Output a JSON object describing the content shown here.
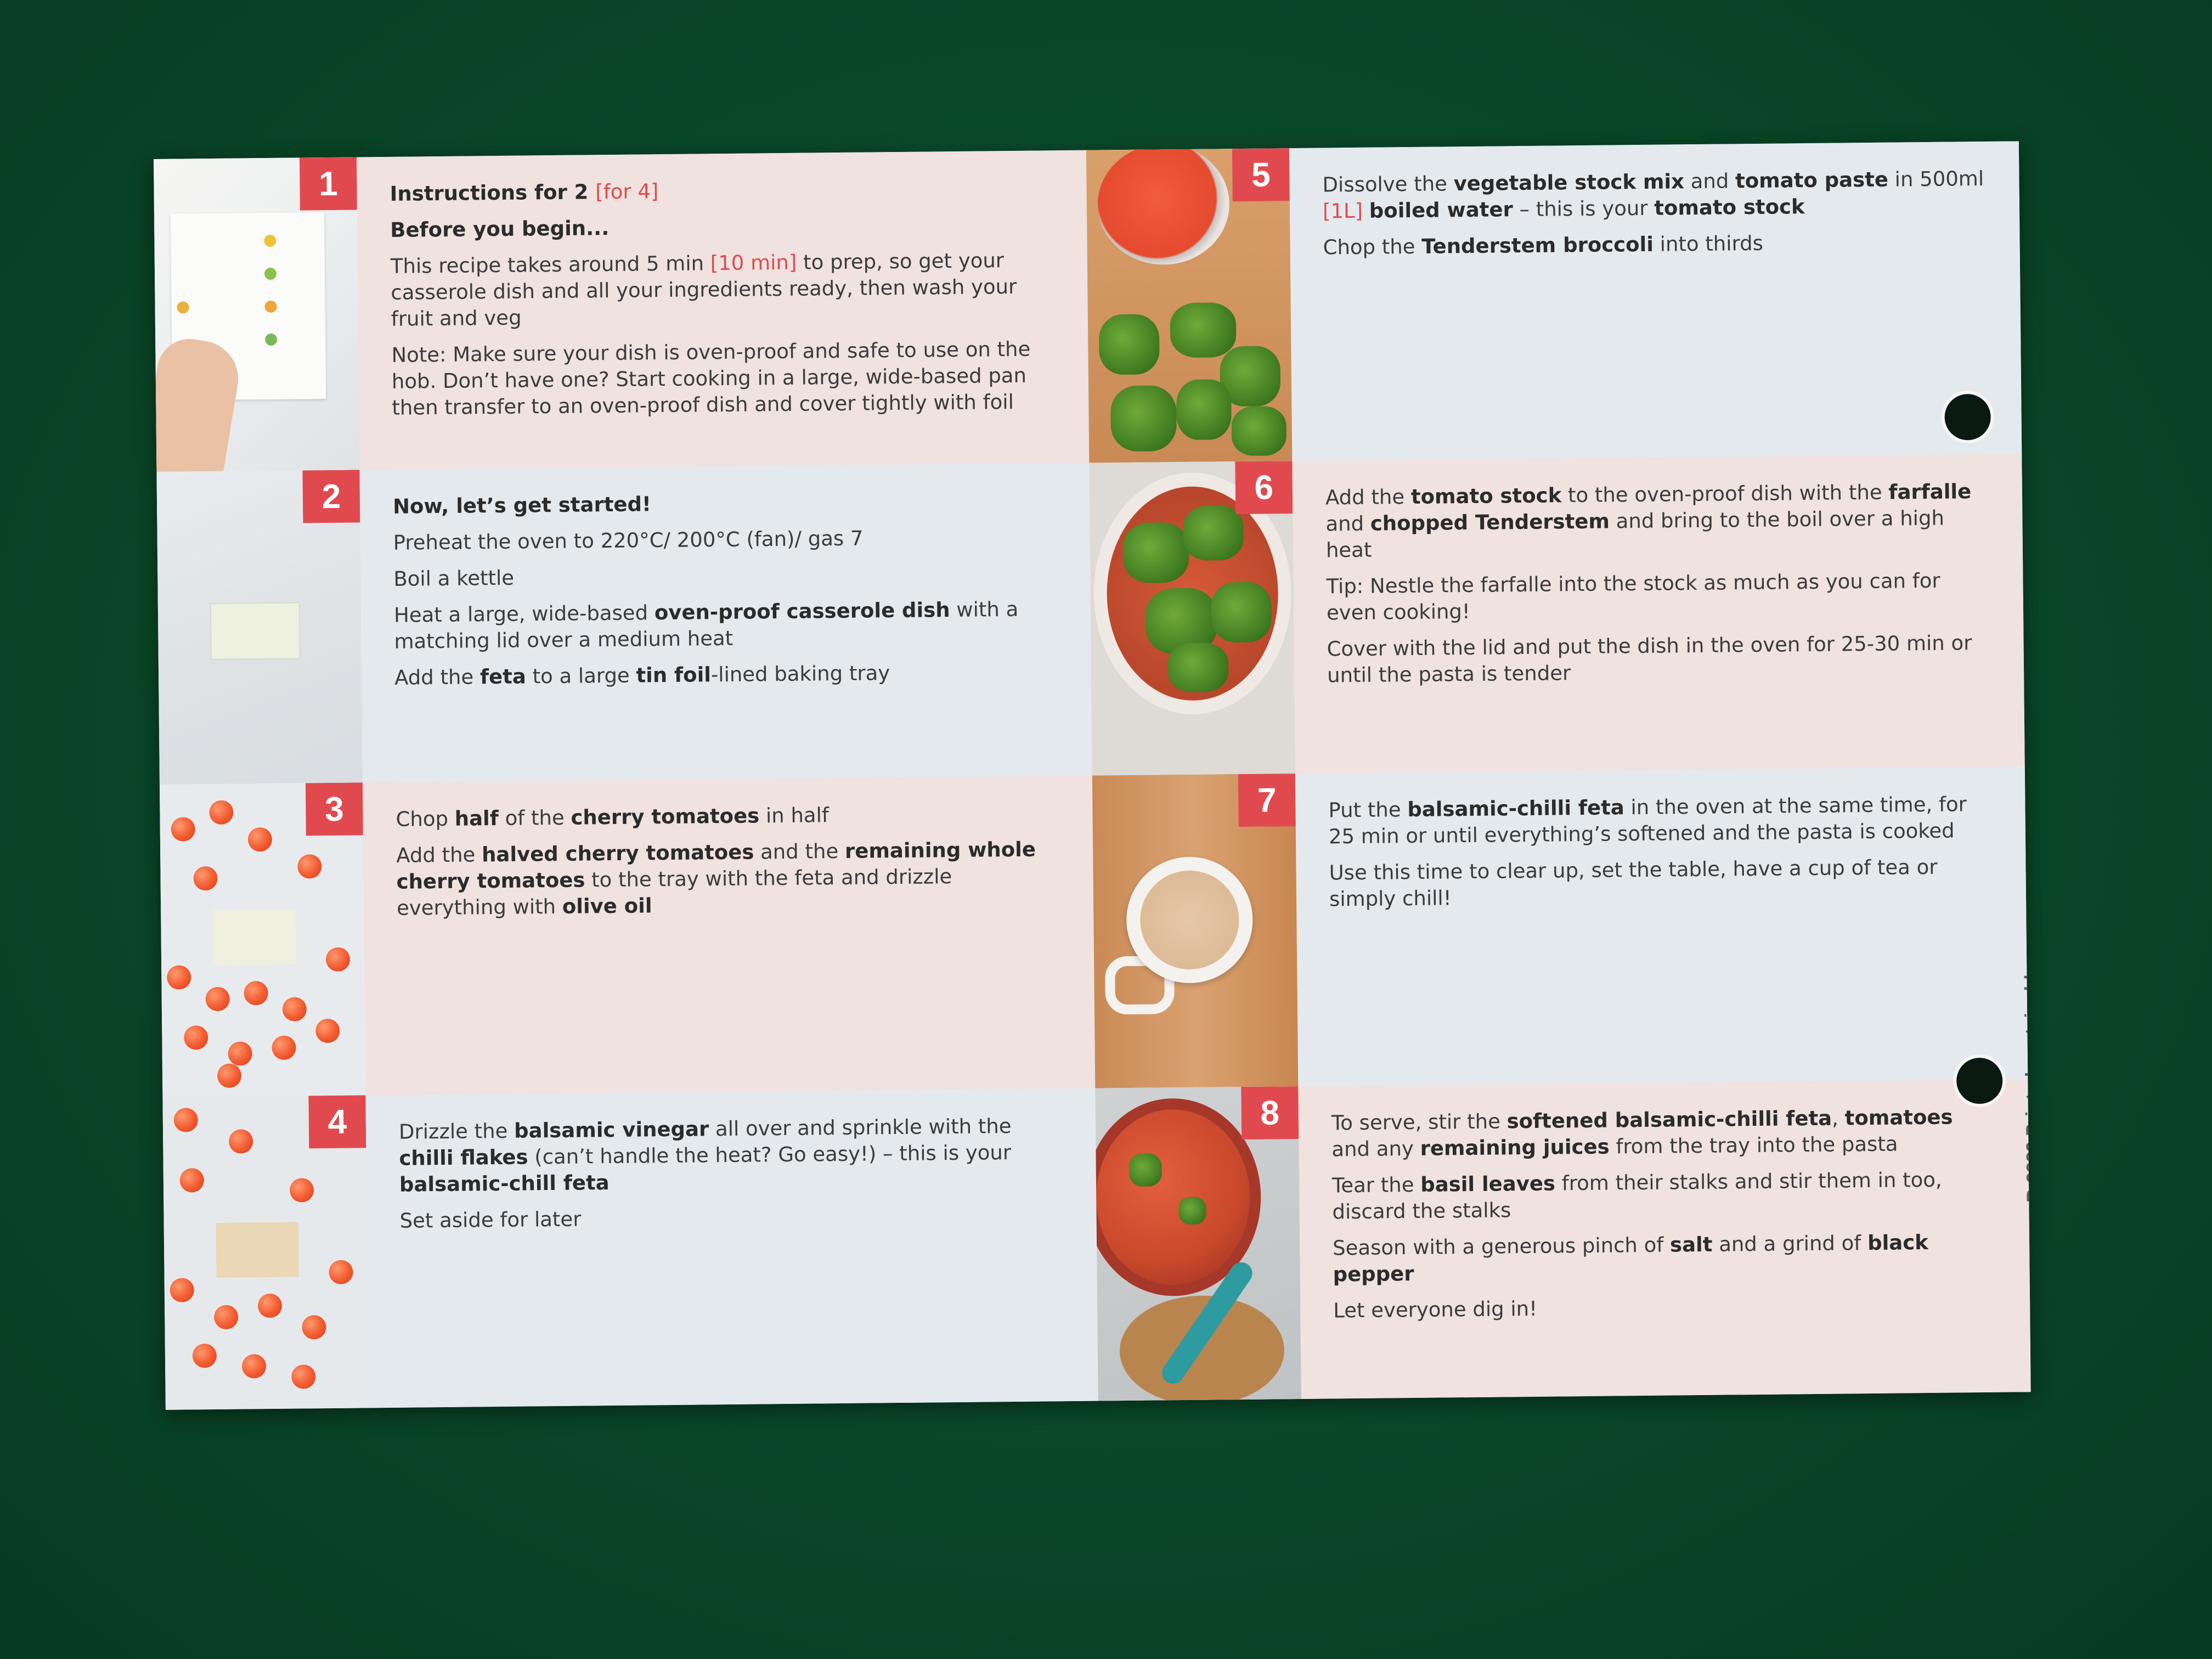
{
  "steps": [
    {
      "number": "1",
      "lines": [
        {
          "parts": [
            {
              "t": "Instructions for 2 ",
              "b": true
            },
            {
              "t": "[for 4]",
              "hl": true
            }
          ]
        },
        {
          "parts": [
            {
              "t": "Before you begin...",
              "b": true
            }
          ]
        },
        {
          "parts": [
            {
              "t": "This recipe takes around 5 min "
            },
            {
              "t": "[10 min]",
              "hl": true
            },
            {
              "t": " to prep, so get your casserole dish and all your ingredients ready, then wash your fruit and veg"
            }
          ]
        },
        {
          "parts": [
            {
              "t": "Note: Make sure your dish is oven-proof and safe to use on the hob. Don’t have one? Start cooking in a large, wide-based pan then transfer to an oven-proof dish and cover tightly with foil"
            }
          ]
        }
      ]
    },
    {
      "number": "2",
      "lines": [
        {
          "parts": [
            {
              "t": "Now, let’s get started!",
              "b": true
            }
          ]
        },
        {
          "parts": [
            {
              "t": "Preheat the oven to 220°C/ 200°C (fan)/ gas 7"
            }
          ]
        },
        {
          "parts": [
            {
              "t": "Boil a kettle"
            }
          ]
        },
        {
          "parts": [
            {
              "t": "Heat a large, wide-based "
            },
            {
              "t": "oven-proof casserole dish",
              "b": true
            },
            {
              "t": " with a matching lid over a medium heat"
            }
          ]
        },
        {
          "parts": [
            {
              "t": "Add the "
            },
            {
              "t": "feta",
              "b": true
            },
            {
              "t": " to a large "
            },
            {
              "t": "tin foil",
              "b": true
            },
            {
              "t": "-lined baking tray"
            }
          ]
        }
      ]
    },
    {
      "number": "3",
      "lines": [
        {
          "parts": [
            {
              "t": "Chop "
            },
            {
              "t": "half",
              "b": true
            },
            {
              "t": " of the "
            },
            {
              "t": "cherry tomatoes",
              "b": true
            },
            {
              "t": " in half"
            }
          ]
        },
        {
          "parts": [
            {
              "t": "Add the "
            },
            {
              "t": "halved cherry tomatoes",
              "b": true
            },
            {
              "t": " and the "
            },
            {
              "t": "remaining whole cherry tomatoes",
              "b": true
            },
            {
              "t": " to the tray with the feta and drizzle everything with "
            },
            {
              "t": "olive oil",
              "b": true
            }
          ]
        }
      ]
    },
    {
      "number": "4",
      "lines": [
        {
          "parts": [
            {
              "t": "Drizzle the "
            },
            {
              "t": "balsamic vinegar",
              "b": true
            },
            {
              "t": " all over and sprinkle with the "
            },
            {
              "t": "chilli flakes",
              "b": true
            },
            {
              "t": " (can’t handle the heat? Go easy!) – this is your "
            },
            {
              "t": "balsamic-chill feta",
              "b": true
            }
          ]
        },
        {
          "parts": [
            {
              "t": "Set aside for later"
            }
          ]
        }
      ]
    },
    {
      "number": "5",
      "lines": [
        {
          "parts": [
            {
              "t": "Dissolve the "
            },
            {
              "t": "vegetable stock mix",
              "b": true
            },
            {
              "t": " and "
            },
            {
              "t": "tomato paste",
              "b": true
            },
            {
              "t": " in 500ml "
            },
            {
              "t": "[1L]",
              "hl": true
            },
            {
              "t": " "
            },
            {
              "t": "boiled water",
              "b": true
            },
            {
              "t": " – this is your "
            },
            {
              "t": "tomato stock",
              "b": true
            }
          ]
        },
        {
          "parts": [
            {
              "t": "Chop the "
            },
            {
              "t": "Tenderstem broccoli",
              "b": true
            },
            {
              "t": " into thirds"
            }
          ]
        }
      ]
    },
    {
      "number": "6",
      "lines": [
        {
          "parts": [
            {
              "t": "Add the "
            },
            {
              "t": "tomato stock",
              "b": true
            },
            {
              "t": " to the oven-proof dish with the "
            },
            {
              "t": "farfalle",
              "b": true
            },
            {
              "t": " and "
            },
            {
              "t": "chopped Tenderstem",
              "b": true
            },
            {
              "t": " and bring to the boil over a high heat"
            }
          ]
        },
        {
          "parts": [
            {
              "t": "Tip: Nestle the farfalle into the stock as much as you can for even cooking!"
            }
          ]
        },
        {
          "parts": [
            {
              "t": "Cover with the lid and put the dish in the oven for 25-30 min or until the pasta is tender"
            }
          ]
        }
      ]
    },
    {
      "number": "7",
      "lines": [
        {
          "parts": [
            {
              "t": "Put the "
            },
            {
              "t": "balsamic-chilli feta",
              "b": true
            },
            {
              "t": " in the oven at the same time, for 25 min or until everything’s softened and the pasta is cooked"
            }
          ]
        },
        {
          "parts": [
            {
              "t": "Use this time to clear up, set the table, have a cup of tea or simply chill!"
            }
          ]
        }
      ]
    },
    {
      "number": "8",
      "lines": [
        {
          "parts": [
            {
              "t": "To serve, stir the "
            },
            {
              "t": "softened balsamic-chilli feta",
              "b": true
            },
            {
              "t": ", "
            },
            {
              "t": "tomatoes",
              "b": true
            },
            {
              "t": " and any "
            },
            {
              "t": "remaining juices",
              "b": true
            },
            {
              "t": " from the tray into the pasta"
            }
          ]
        },
        {
          "parts": [
            {
              "t": "Tear the "
            },
            {
              "t": "basil leaves",
              "b": true
            },
            {
              "t": " from their stalks and stir them in too, discard the stalks"
            }
          ]
        },
        {
          "parts": [
            {
              "t": "Season with a generous pinch of "
            },
            {
              "t": "salt",
              "b": true
            },
            {
              "t": " and a grind of "
            },
            {
              "t": "black pepper",
              "b": true
            }
          ]
        },
        {
          "parts": [
            {
              "t": "Let everyone dig in!"
            }
          ]
        }
      ]
    }
  ],
  "side_text": "R-3389   Printed sustainably",
  "colors": {
    "accent": "#e04a4f",
    "felt": "#0a4a29",
    "pink_panel": "#efe2df",
    "blue_panel": "#e4e9ee"
  }
}
